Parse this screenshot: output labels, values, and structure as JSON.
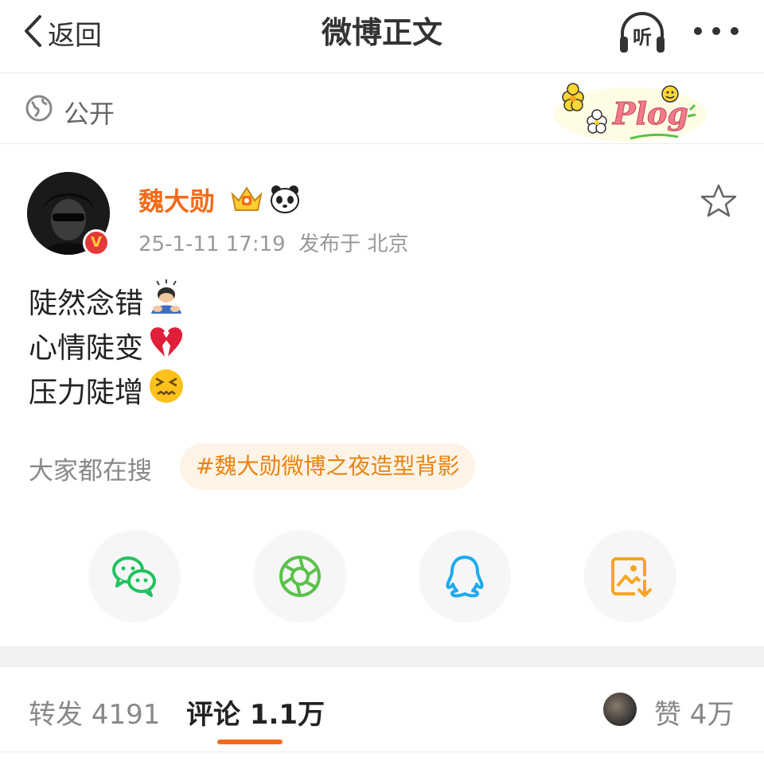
{
  "nav": {
    "back_label": "返回",
    "title": "微博正文",
    "listen_label": "听",
    "back_icon": "chevron-left-icon",
    "more_icon": "more-dots-icon"
  },
  "visibility": {
    "label": "公开",
    "icon": "globe-icon",
    "sticker_text": "Plog"
  },
  "post": {
    "author": "魏大勋",
    "author_color": "#f26c1a",
    "timestamp": "25-1-11 17:19",
    "location_prefix": "发布于",
    "location": "北京",
    "lines": [
      {
        "text": "陡然念错",
        "emoji": "bowing-person-emoji"
      },
      {
        "text": "心情陡变",
        "emoji": "broken-heart-emoji"
      },
      {
        "text": "压力陡增",
        "emoji": "confounded-face-emoji"
      }
    ]
  },
  "trending": {
    "label": "大家都在搜",
    "tag": "#魏大勋微博之夜造型背影"
  },
  "share": [
    {
      "name": "wechat",
      "icon": "wechat-icon",
      "color": "#21c25f"
    },
    {
      "name": "moments",
      "icon": "moments-icon",
      "color": "#5ac24a"
    },
    {
      "name": "qq",
      "icon": "qq-icon",
      "color": "#1eaaf1"
    },
    {
      "name": "save-image",
      "icon": "save-image-icon",
      "color": "#f5a623"
    }
  ],
  "tabs": {
    "repost": "转发 4191",
    "comment": "评论 1.1万",
    "like": "赞 4万"
  },
  "accent": "#f26c1a"
}
